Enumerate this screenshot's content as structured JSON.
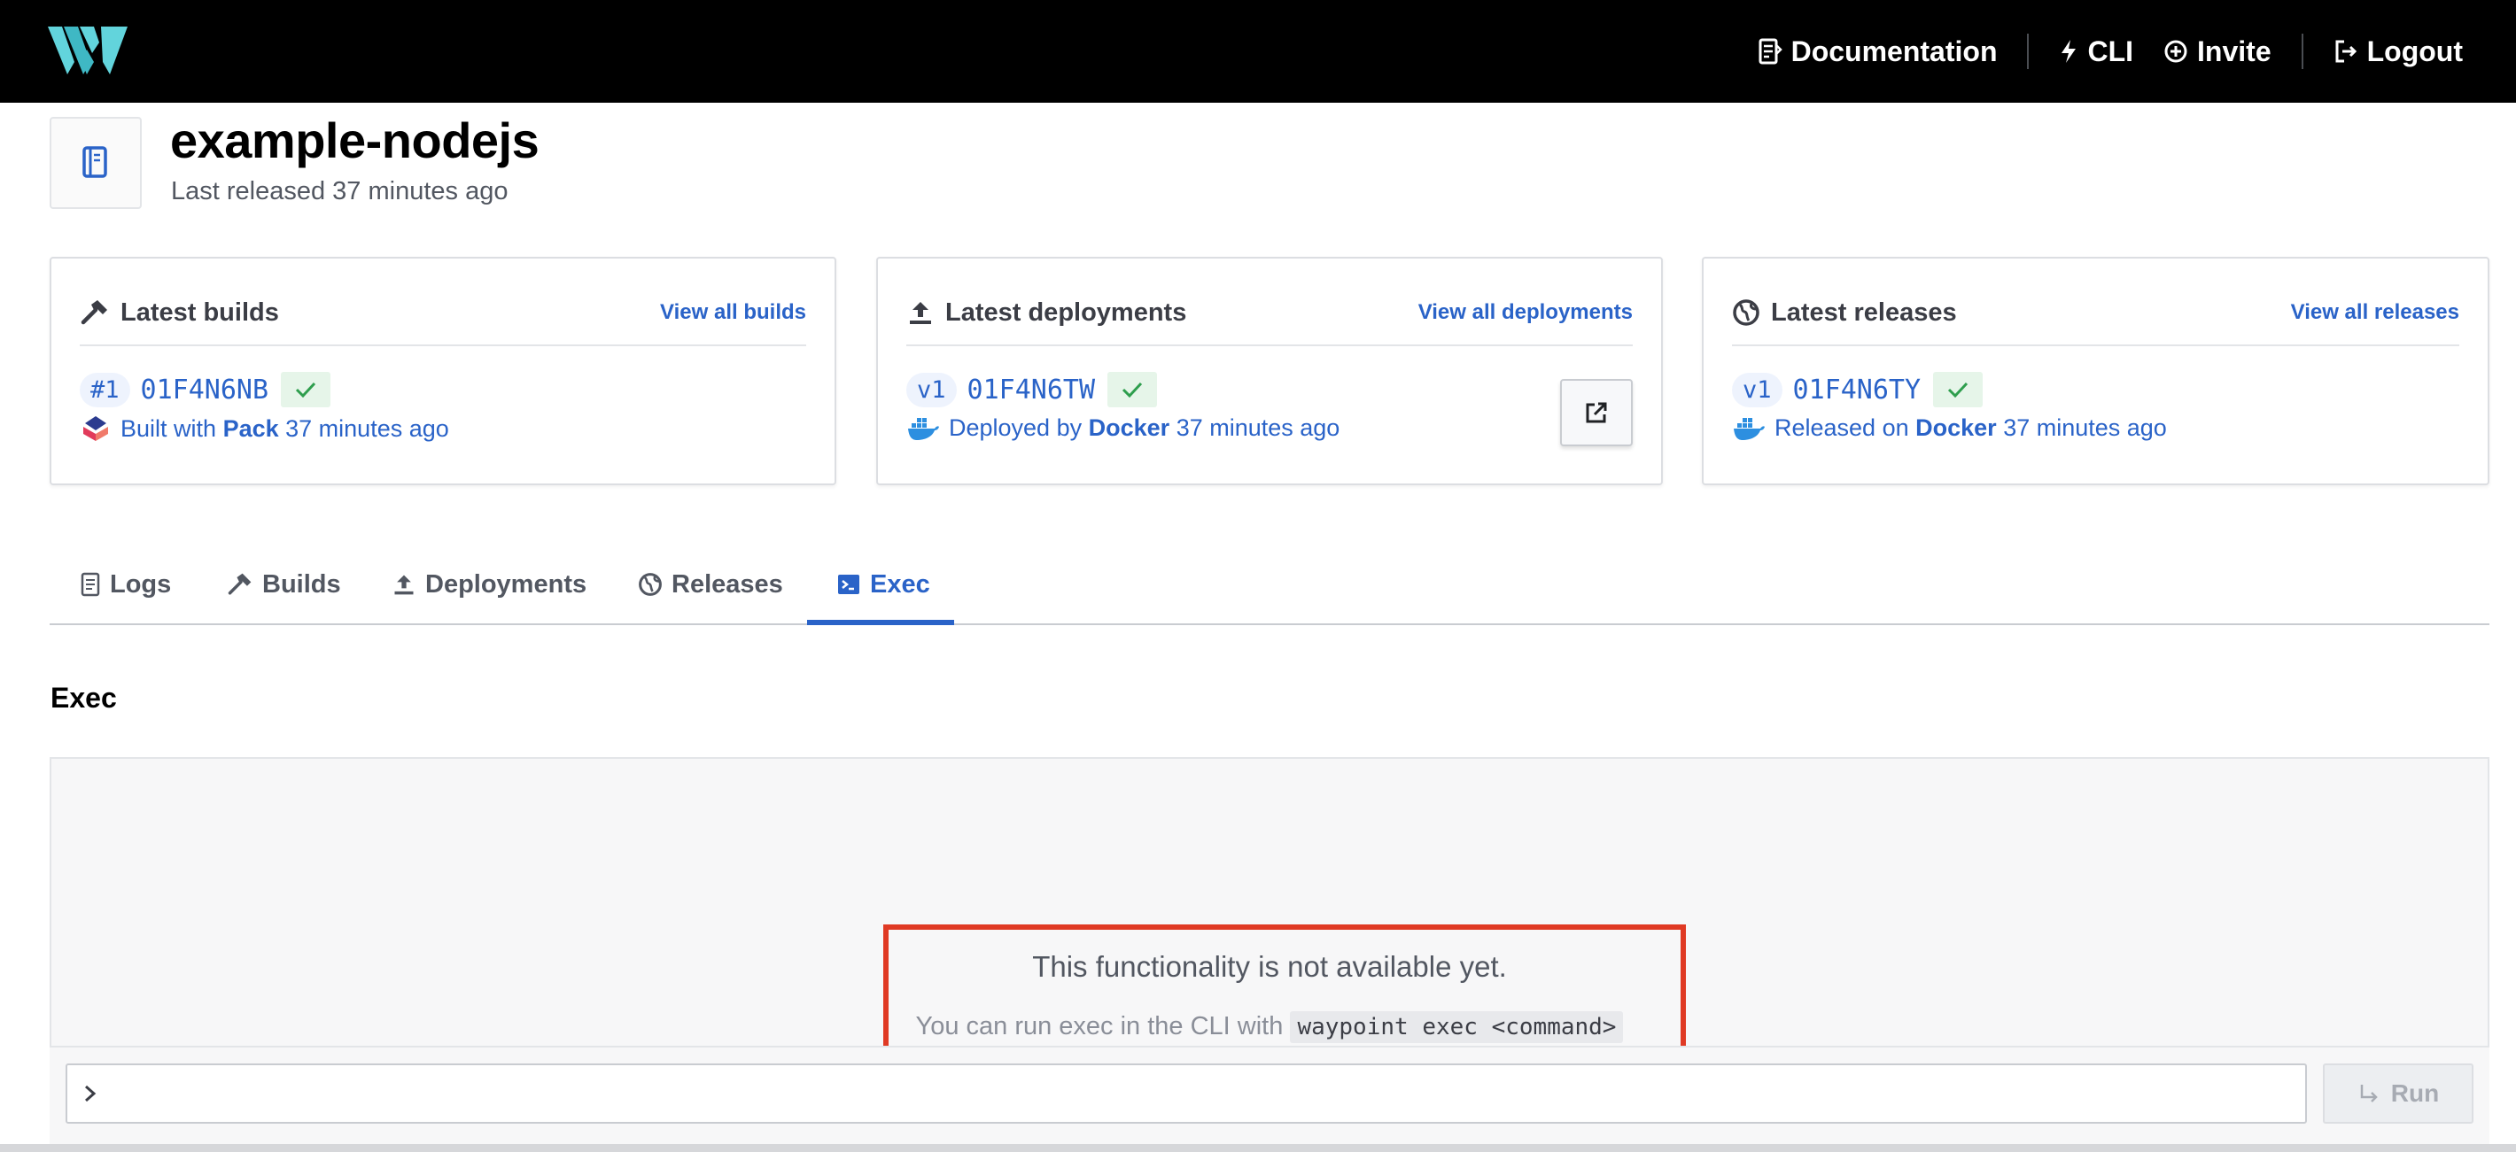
{
  "nav": {
    "documentation": "Documentation",
    "cli": "CLI",
    "invite": "Invite",
    "logout": "Logout"
  },
  "project": {
    "name": "example-nodejs",
    "last_released": "Last released 37 minutes ago"
  },
  "cards": {
    "builds": {
      "title": "Latest builds",
      "link": "View all builds",
      "tag": "#1",
      "id": "01F4N6NB",
      "prefix": "Built with",
      "by": "Pack",
      "when": "37 minutes ago"
    },
    "deployments": {
      "title": "Latest deployments",
      "link": "View all deployments",
      "tag": "v1",
      "id": "01F4N6TW",
      "prefix": "Deployed by",
      "by": "Docker",
      "when": "37 minutes ago"
    },
    "releases": {
      "title": "Latest releases",
      "link": "View all releases",
      "tag": "v1",
      "id": "01F4N6TY",
      "prefix": "Released on",
      "by": "Docker",
      "when": "37 minutes ago"
    }
  },
  "tabs": [
    {
      "label": "Logs"
    },
    {
      "label": "Builds"
    },
    {
      "label": "Deployments"
    },
    {
      "label": "Releases"
    },
    {
      "label": "Exec",
      "active": true
    }
  ],
  "exec": {
    "section_title": "Exec",
    "message": "This functionality is not available yet.",
    "hint_prefix": "You can run exec in the CLI with",
    "hint_code": "waypoint exec <command>",
    "prompt": ">",
    "run_label": "Run"
  },
  "colors": {
    "accent": "#2a63c8",
    "success": "#2e9e4d",
    "highlight_box": "#e03a24",
    "topbar": "#000000",
    "logo": "#62d4dc"
  }
}
